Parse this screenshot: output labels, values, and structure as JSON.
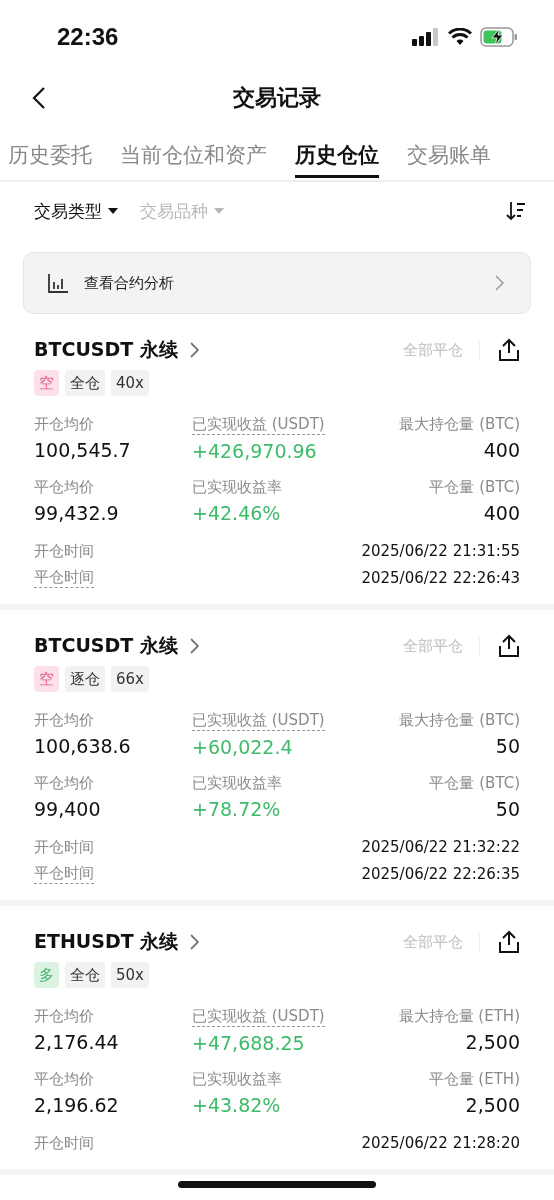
{
  "status_bar": {
    "time": "22:36"
  },
  "nav": {
    "title": "交易记录"
  },
  "tabs": [
    {
      "label": "历史委托",
      "selected": false
    },
    {
      "label": "当前仓位和资产",
      "selected": false
    },
    {
      "label": "历史仓位",
      "selected": true
    },
    {
      "label": "交易账单",
      "selected": false
    }
  ],
  "filters": [
    {
      "label": "交易类型",
      "active": true
    },
    {
      "label": "交易品种",
      "active": false
    }
  ],
  "analysis_link": {
    "label": "查看合约分析"
  },
  "positions": [
    {
      "symbol": "BTCUSDT 永续",
      "close_all": "全部平仓",
      "side": {
        "label": "空",
        "kind": "short"
      },
      "tags": [
        "全仓",
        "40x"
      ],
      "metrics": [
        {
          "label": "开仓均价",
          "value": "100,545.7",
          "dashed": false,
          "positive": false
        },
        {
          "label": "已实现收益 (USDT)",
          "value": "+426,970.96",
          "dashed": true,
          "positive": true
        },
        {
          "label": "最大持仓量 (BTC)",
          "value": "400",
          "dashed": false,
          "positive": false
        },
        {
          "label": "平仓均价",
          "value": "99,432.9",
          "dashed": false,
          "positive": false
        },
        {
          "label": "已实现收益率",
          "value": "+42.46%",
          "dashed": false,
          "positive": true
        },
        {
          "label": "平仓量 (BTC)",
          "value": "400",
          "dashed": false,
          "positive": false
        }
      ],
      "times": [
        {
          "label": "开仓时间",
          "value": "2025/06/22 21:31:55",
          "dashed": false
        },
        {
          "label": "平仓时间",
          "value": "2025/06/22 22:26:43",
          "dashed": true
        }
      ]
    },
    {
      "symbol": "BTCUSDT 永续",
      "close_all": "全部平仓",
      "side": {
        "label": "空",
        "kind": "short"
      },
      "tags": [
        "逐仓",
        "66x"
      ],
      "metrics": [
        {
          "label": "开仓均价",
          "value": "100,638.6",
          "dashed": false,
          "positive": false
        },
        {
          "label": "已实现收益 (USDT)",
          "value": "+60,022.4",
          "dashed": true,
          "positive": true
        },
        {
          "label": "最大持仓量 (BTC)",
          "value": "50",
          "dashed": false,
          "positive": false
        },
        {
          "label": "平仓均价",
          "value": "99,400",
          "dashed": false,
          "positive": false
        },
        {
          "label": "已实现收益率",
          "value": "+78.72%",
          "dashed": false,
          "positive": true
        },
        {
          "label": "平仓量 (BTC)",
          "value": "50",
          "dashed": false,
          "positive": false
        }
      ],
      "times": [
        {
          "label": "开仓时间",
          "value": "2025/06/22 21:32:22",
          "dashed": false
        },
        {
          "label": "平仓时间",
          "value": "2025/06/22 22:26:35",
          "dashed": true
        }
      ]
    },
    {
      "symbol": "ETHUSDT 永续",
      "close_all": "全部平仓",
      "side": {
        "label": "多",
        "kind": "long"
      },
      "tags": [
        "全仓",
        "50x"
      ],
      "metrics": [
        {
          "label": "开仓均价",
          "value": "2,176.44",
          "dashed": false,
          "positive": false
        },
        {
          "label": "已实现收益 (USDT)",
          "value": "+47,688.25",
          "dashed": true,
          "positive": true
        },
        {
          "label": "最大持仓量 (ETH)",
          "value": "2,500",
          "dashed": false,
          "positive": false
        },
        {
          "label": "平仓均价",
          "value": "2,196.62",
          "dashed": false,
          "positive": false
        },
        {
          "label": "已实现收益率",
          "value": "+43.82%",
          "dashed": false,
          "positive": true
        },
        {
          "label": "平仓量 (ETH)",
          "value": "2,500",
          "dashed": false,
          "positive": false
        }
      ],
      "times": [
        {
          "label": "开仓时间",
          "value": "2025/06/22 21:28:20",
          "dashed": false
        }
      ]
    }
  ]
}
